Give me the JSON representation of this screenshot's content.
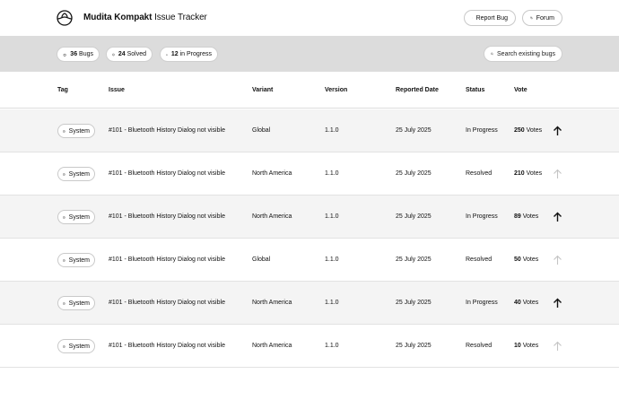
{
  "header": {
    "brand_bold": "Mudita Kompakt",
    "brand_rest": " Issue Tracker",
    "report_label": "Report Bug",
    "forum_label": "Forum"
  },
  "stats": {
    "bugs_count": "36",
    "bugs_label": " Bugs",
    "solved_count": "24",
    "solved_label": " Solved",
    "progress_count": "12",
    "progress_label": " in Progress",
    "search_label": "Search existing bugs"
  },
  "table": {
    "columns": [
      "Tag",
      "Issue",
      "Variant",
      "Version",
      "Reported Date",
      "Status",
      "Vote"
    ],
    "rows": [
      {
        "tag": "System",
        "issue": "#101  -  Bluetooth History Dialog not visible",
        "variant": "Global",
        "version": "1.1.0",
        "date": "25 July 2025",
        "status": "In Progress",
        "votes_count": "250",
        "votes_label": " Votes",
        "voted": true
      },
      {
        "tag": "System",
        "issue": "#101  -  Bluetooth History Dialog not visible",
        "variant": "North America",
        "version": "1.1.0",
        "date": "25 July 2025",
        "status": "Resolved",
        "votes_count": "210",
        "votes_label": " Votes",
        "voted": false
      },
      {
        "tag": "System",
        "issue": "#101  -  Bluetooth History Dialog not visible",
        "variant": "North America",
        "version": "1.1.0",
        "date": "25 July 2025",
        "status": "In Progress",
        "votes_count": "89",
        "votes_label": " Votes",
        "voted": true
      },
      {
        "tag": "System",
        "issue": "#101  -  Bluetooth History Dialog not visible",
        "variant": "Global",
        "version": "1.1.0",
        "date": "25 July 2025",
        "status": "Resolved",
        "votes_count": "50",
        "votes_label": " Votes",
        "voted": false
      },
      {
        "tag": "System",
        "issue": "#101  -  Bluetooth History Dialog not visible",
        "variant": "North America",
        "version": "1.1.0",
        "date": "25 July 2025",
        "status": "In Progress",
        "votes_count": "40",
        "votes_label": " Votes",
        "voted": true
      },
      {
        "tag": "System",
        "issue": "#101  -  Bluetooth History Dialog not visible",
        "variant": "North America",
        "version": "1.1.0",
        "date": "25 July 2025",
        "status": "Resolved",
        "votes_count": "10",
        "votes_label": " Votes",
        "voted": false
      }
    ]
  },
  "colors": {
    "stats_bar_bg": "#dcdcdc",
    "alt_row_bg": "#f4f4f4",
    "arrow_active": "#111111",
    "arrow_inactive": "#c4c4c4"
  },
  "icons": {
    "logo": "mudita-logo-icon",
    "report": "bug-icon",
    "forum": "chat-bubbles-icon",
    "bugs": "bug-icon",
    "solved": "check-circle-icon",
    "progress": "warning-triangle-icon",
    "search": "search-icon",
    "tag": "info-circle-icon",
    "vote": "arrow-up-icon"
  }
}
